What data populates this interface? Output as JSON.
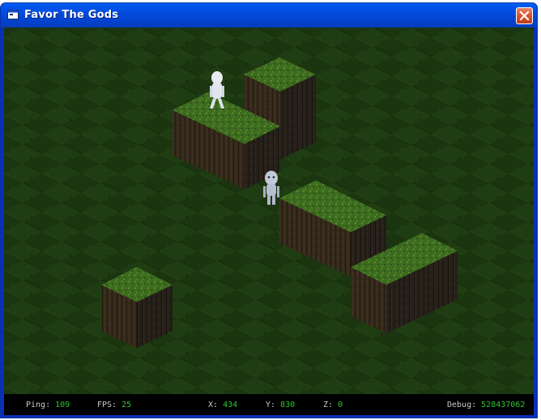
{
  "window": {
    "title": "Favor The Gods",
    "icons": {
      "app": "window-app-icon",
      "close": "close-x-icon"
    }
  },
  "colors": {
    "title_bar": "#0548d8",
    "close_button": "#d9532d",
    "grass": "#2f5a1a",
    "dirt_side": "#3a2e1f",
    "status_label": "#c8c8c8",
    "status_value": "#2fc42f"
  },
  "status": {
    "ping": {
      "label": "Ping:",
      "value": "109"
    },
    "fps": {
      "label": "FPS:",
      "value": "25"
    },
    "x": {
      "label": "X:",
      "value": "434"
    },
    "y": {
      "label": "Y:",
      "value": "830"
    },
    "z": {
      "label": "Z:",
      "value": "0"
    },
    "debug": {
      "label": "Debug:",
      "value": "528437062"
    }
  }
}
